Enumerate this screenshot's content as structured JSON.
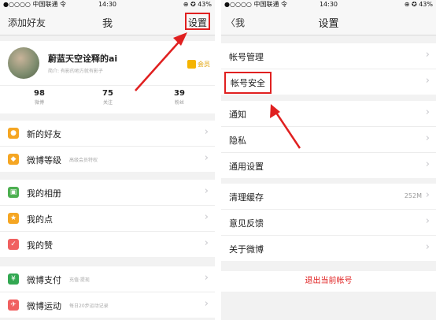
{
  "left": {
    "status": {
      "carrier": "●○○○○ 中国联通 令",
      "time": "14:30",
      "battery": "⊕ ✪ 43%"
    },
    "nav": {
      "add_friend": "添加好友",
      "title": "我",
      "settings": "设置"
    },
    "profile": {
      "name": "蔚蓝天空诠释的ai",
      "subtitle": "简介: 有影的地方就有影子",
      "vip": "会员"
    },
    "stats": [
      {
        "num": "98",
        "label": "微博"
      },
      {
        "num": "75",
        "label": "关注"
      },
      {
        "num": "39",
        "label": "粉丝"
      }
    ],
    "group1": [
      {
        "icon": "new-friends-icon",
        "label": "新的好友",
        "sub": "",
        "color": "#f5a623"
      },
      {
        "icon": "weibo-level-icon",
        "label": "微博等级",
        "sub": "高级会员特权",
        "color": "#f5a623"
      }
    ],
    "group2": [
      {
        "icon": "album-icon",
        "label": "我的相册",
        "sub": "",
        "color": "#4caf50"
      },
      {
        "icon": "likes-icon",
        "label": "我的点",
        "sub": "",
        "color": "#f5a623"
      },
      {
        "icon": "thumb-icon",
        "label": "我的赞",
        "sub": "",
        "color": "#f06060"
      }
    ],
    "group3": [
      {
        "icon": "pay-icon",
        "label": "微博支付",
        "sub": "充值·提现",
        "color": "#33a852"
      },
      {
        "icon": "sport-icon",
        "label": "微博运动",
        "sub": "每日20步运动记录",
        "color": "#f06060"
      }
    ]
  },
  "right": {
    "status": {
      "carrier": "●○○○○ 中国联通 令",
      "time": "14:30",
      "battery": "⊕ ✪ 43%"
    },
    "nav": {
      "back": "〈我",
      "title": "设置"
    },
    "group1": [
      {
        "label": "帐号管理"
      },
      {
        "label": "帐号安全"
      }
    ],
    "group2": [
      {
        "label": "通知"
      },
      {
        "label": "隐私"
      },
      {
        "label": "通用设置"
      }
    ],
    "group3": [
      {
        "label": "清理缓存",
        "value": "252M"
      },
      {
        "label": "意见反馈",
        "value": ""
      },
      {
        "label": "关于微博",
        "value": ""
      }
    ],
    "logout": "退出当前帐号"
  },
  "colors": {
    "accent_red": "#e02020",
    "vip_gold": "#f5b400"
  }
}
